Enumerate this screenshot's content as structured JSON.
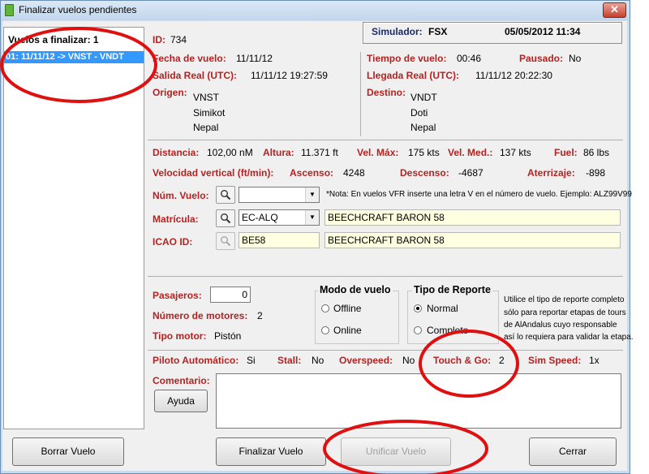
{
  "window": {
    "title": "Finalizar vuelos pendientes",
    "close_glyph": "✕"
  },
  "list": {
    "title": "Vuelos a finalizar: 1",
    "items": [
      "01: 11/11/12 -> VNST - VNDT"
    ]
  },
  "header": {
    "id_label": "ID:",
    "id_value": "734",
    "sim_label": "Simulador:",
    "sim_value": "FSX",
    "sim_datetime": "05/05/2012 11:34"
  },
  "flight": {
    "fecha_label": "Fecha de vuelo:",
    "fecha_value": "11/11/12",
    "salida_label": "Salida Real (UTC):",
    "salida_value": "11/11/12 19:27:59",
    "origen_label": "Origen:",
    "origen": [
      "VNST",
      "Simikot",
      "Nepal"
    ],
    "tiempo_label": "Tiempo de vuelo:",
    "tiempo_value": "00:46",
    "pausado_label": "Pausado:",
    "pausado_value": "No",
    "llegada_label": "Llegada Real (UTC):",
    "llegada_value": "11/11/12 20:22:30",
    "destino_label": "Destino:",
    "destino": [
      "VNDT",
      "Doti",
      "Nepal"
    ]
  },
  "stats": {
    "distancia_label": "Distancia:",
    "distancia_value": "102,00 nM",
    "altura_label": "Altura:",
    "altura_value": "11.371 ft",
    "velmax_label": "Vel. Máx:",
    "velmax_value": "175 kts",
    "velmed_label": "Vel. Med.:",
    "velmed_value": "137 kts",
    "fuel_label": "Fuel:",
    "fuel_value": "86 lbs",
    "vv_label": "Velocidad vertical (ft/min):",
    "ascenso_label": "Ascenso:",
    "ascenso_value": "4248",
    "descenso_label": "Descenso:",
    "descenso_value": "-4687",
    "aterrizaje_label": "Aterrizaje:",
    "aterrizaje_value": "-898"
  },
  "form": {
    "numvuelo_label": "Núm. Vuelo:",
    "numvuelo_value": "",
    "note": "*Nota: En vuelos VFR inserte una letra V en el número de vuelo. Ejemplo: ALZ99V99",
    "matricula_label": "Matrícula:",
    "matricula_value": "EC-ALQ",
    "matricula_desc": "BEECHCRAFT BARON 58",
    "icao_label": "ICAO ID:",
    "icao_value": "BE58",
    "icao_desc": "BEECHCRAFT BARON 58"
  },
  "aircraft": {
    "pasajeros_label": "Pasajeros:",
    "pasajeros_value": "0",
    "motores_label": "Número de motores:",
    "motores_value": "2",
    "tipomotor_label": "Tipo motor:",
    "tipomotor_value": "Pistón"
  },
  "modo": {
    "title": "Modo de vuelo",
    "opt1": "Offline",
    "opt2": "Online"
  },
  "reporte": {
    "title": "Tipo de Reporte",
    "opt1": "Normal",
    "opt2": "Completo",
    "info": [
      "Utilice el tipo de reporte completo",
      "sólo para reportar etapas de tours",
      "de AlAndalus cuyo responsable",
      "así lo requiera para validar la etapa."
    ]
  },
  "flags": {
    "piloto_label": "Piloto Automático:",
    "piloto_value": "Si",
    "stall_label": "Stall:",
    "stall_value": "No",
    "overspeed_label": "Overspeed:",
    "overspeed_value": "No",
    "touch_label": "Touch & Go:",
    "touch_value": "2",
    "simspeed_label": "Sim Speed:",
    "simspeed_value": "1x"
  },
  "comentario": {
    "label": "Comentario:",
    "help_button": "Ayuda",
    "value": ""
  },
  "buttons": {
    "borrar": "Borrar Vuelo",
    "finalizar": "Finalizar Vuelo",
    "unificar": "Unificar Vuelo",
    "cerrar": "Cerrar"
  },
  "colors": {
    "label_red": "#b52222",
    "selection_blue": "#3399ff",
    "annotation_red": "#e01010",
    "field_yellow": "#ffffe1"
  },
  "icons": {
    "magnifier": "magnifier-icon",
    "combo_arrow": "chevron-down-icon",
    "app": "app-icon"
  }
}
